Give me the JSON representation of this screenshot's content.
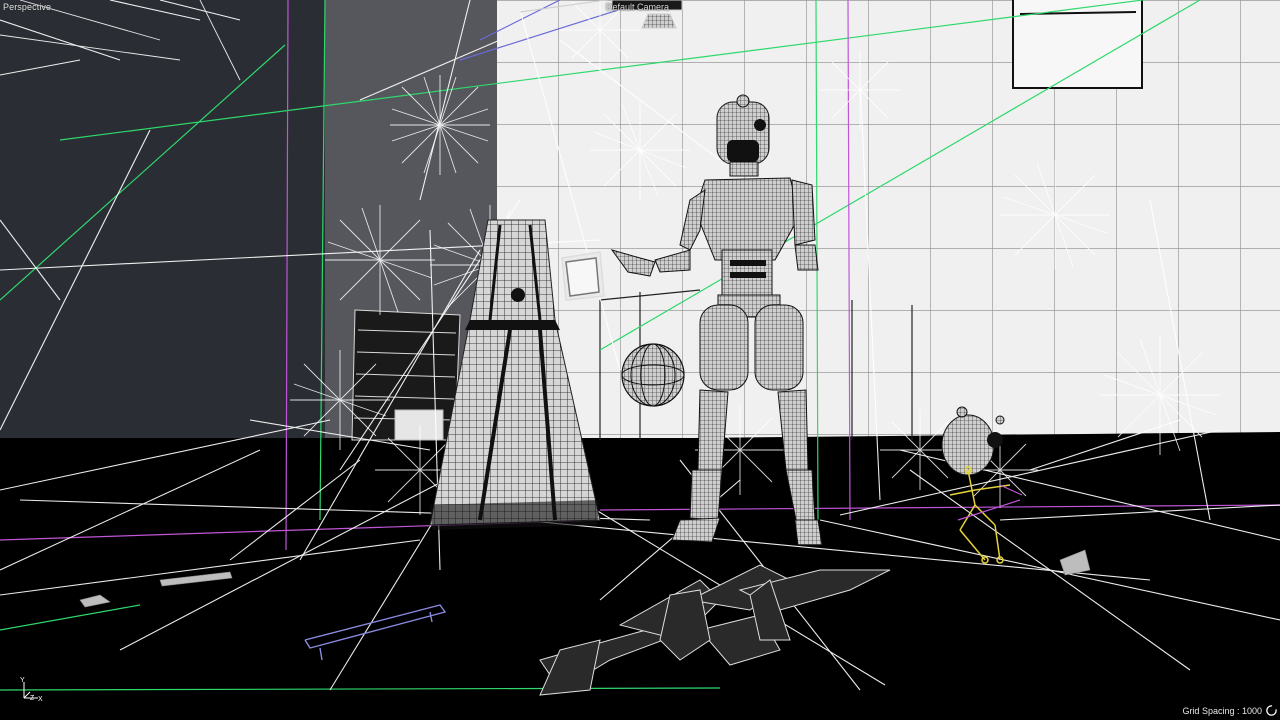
{
  "viewport": {
    "view_name": "Perspective",
    "camera_name": "Default Camera",
    "grid_spacing_label": "Grid Spacing : 1000",
    "axis_y": "Y",
    "axis_x": "X",
    "axis_z": "Z"
  },
  "icons": {
    "orbit": "orbit-icon",
    "axis": "axis-gizmo-icon",
    "camera": "camera-icon"
  },
  "colors": {
    "background": "#000000",
    "back_wall": "#f2f2f2",
    "dark_wall": "#2a2d33",
    "mid_wall": "#5a5c60",
    "wire": "#ffffff",
    "guide_green": "#2fd86c",
    "guide_magenta": "#c055d8",
    "guide_blue": "#6a6ad8",
    "bone_yellow": "#e6d23c"
  }
}
